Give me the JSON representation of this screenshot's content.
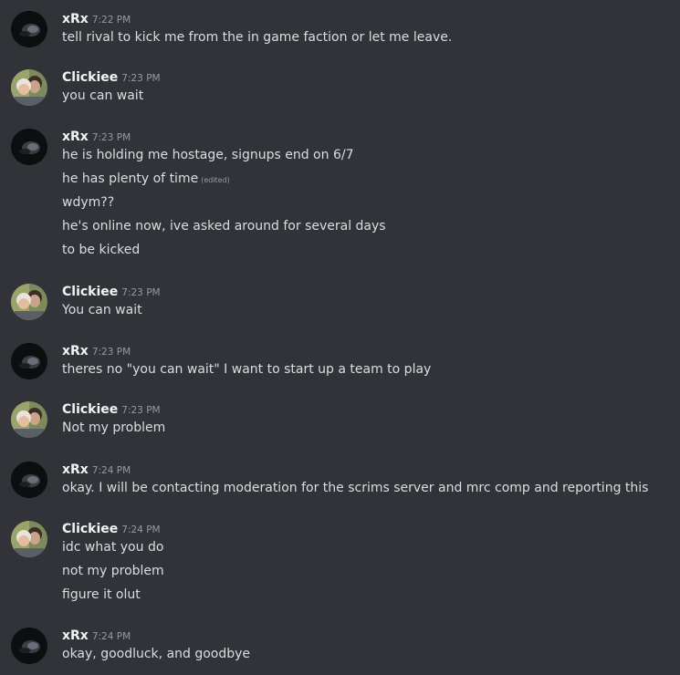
{
  "messages": [
    {
      "author": "xRx",
      "time": "7:22 PM",
      "avatar": "dark-icon",
      "lines": [
        {
          "text": "tell rival to kick me from the in game faction or let me leave."
        }
      ]
    },
    {
      "author": "Clickiee",
      "time": "7:23 PM",
      "avatar": "photo-icon",
      "lines": [
        {
          "text": "you can wait"
        }
      ]
    },
    {
      "author": "xRx",
      "time": "7:23 PM",
      "avatar": "dark-icon",
      "lines": [
        {
          "text": "he is holding me hostage, signups end on 6/7"
        },
        {
          "text": "he has plenty of time",
          "edited": "(edited)"
        },
        {
          "text": "wdym??"
        },
        {
          "text": "he's online now, ive asked around for several days"
        },
        {
          "text": "to be kicked"
        }
      ]
    },
    {
      "author": "Clickiee",
      "time": "7:23 PM",
      "avatar": "photo-icon",
      "lines": [
        {
          "text": "You can wait"
        }
      ]
    },
    {
      "author": "xRx",
      "time": "7:23 PM",
      "avatar": "dark-icon",
      "lines": [
        {
          "text": "theres no \"you can wait\" I want to start up a team to play"
        }
      ]
    },
    {
      "author": "Clickiee",
      "time": "7:23 PM",
      "avatar": "photo-icon",
      "lines": [
        {
          "text": "Not my problem"
        }
      ]
    },
    {
      "author": "xRx",
      "time": "7:24 PM",
      "avatar": "dark-icon",
      "lines": [
        {
          "text": "okay. I will be contacting moderation for the scrims server and mrc comp and reporting this"
        }
      ]
    },
    {
      "author": "Clickiee",
      "time": "7:24 PM",
      "avatar": "photo-icon",
      "lines": [
        {
          "text": "idc what you do"
        },
        {
          "text": "not my problem"
        },
        {
          "text": "figure it olut"
        }
      ]
    },
    {
      "author": "xRx",
      "time": "7:24 PM",
      "avatar": "dark-icon",
      "lines": [
        {
          "text": "okay, goodluck, and goodbye"
        }
      ]
    }
  ]
}
